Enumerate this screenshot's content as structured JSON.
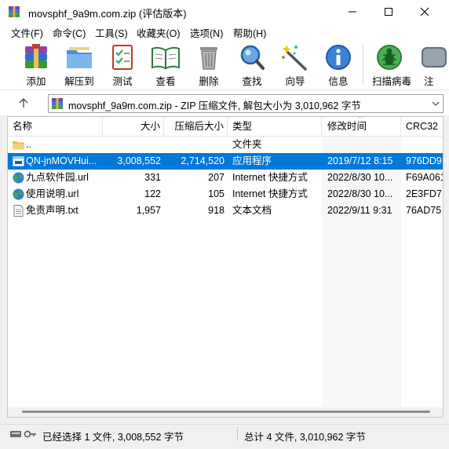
{
  "window": {
    "title": "movsphf_9a9m.com.zip (评估版本)"
  },
  "menu": [
    "文件(F)",
    "命令(C)",
    "工具(S)",
    "收藏夹(O)",
    "选项(N)",
    "帮助(H)"
  ],
  "toolbar": {
    "add": "添加",
    "extract_to": "解压到",
    "test": "测试",
    "view": "查看",
    "delete": "删除",
    "find": "查找",
    "wizard": "向导",
    "info": "信息",
    "virus_scan": "扫描病毒",
    "more": "注"
  },
  "address": {
    "text": "movsphf_9a9m.com.zip - ZIP 压缩文件, 解包大小为 3,010,962 字节"
  },
  "columns": {
    "name": "名称",
    "size": "大小",
    "packed": "压缩后大小",
    "type": "类型",
    "modified": "修改时间",
    "crc": "CRC32"
  },
  "files": [
    {
      "name": "..",
      "size": "",
      "packed": "",
      "type": "文件夹",
      "modified": "",
      "crc": "",
      "icon": "folder-icon"
    },
    {
      "name": "QN-jnMOVHui...",
      "size": "3,008,552",
      "packed": "2,714,520",
      "type": "应用程序",
      "modified": "2019/7/12 8:15",
      "crc": "976DD9",
      "icon": "exe-icon"
    },
    {
      "name": "九点软件园.url",
      "size": "331",
      "packed": "207",
      "type": "Internet 快捷方式",
      "modified": "2022/8/30 10...",
      "crc": "F69A061",
      "icon": "globe-icon"
    },
    {
      "name": "使用说明.url",
      "size": "122",
      "packed": "105",
      "type": "Internet 快捷方式",
      "modified": "2022/8/30 10...",
      "crc": "2E3FD7.",
      "icon": "globe-icon"
    },
    {
      "name": "免责声明.txt",
      "size": "1,957",
      "packed": "918",
      "type": "文本文档",
      "modified": "2022/9/11 9:31",
      "crc": "76AD75",
      "icon": "text-file-icon"
    }
  ],
  "status": {
    "selected": "已经选择 1 文件, 3,008,552 字节",
    "total": "总计 4 文件, 3,010,962 字节"
  },
  "colors": {
    "selection": "#0078d7",
    "window_bg": "#f0f0f0"
  }
}
